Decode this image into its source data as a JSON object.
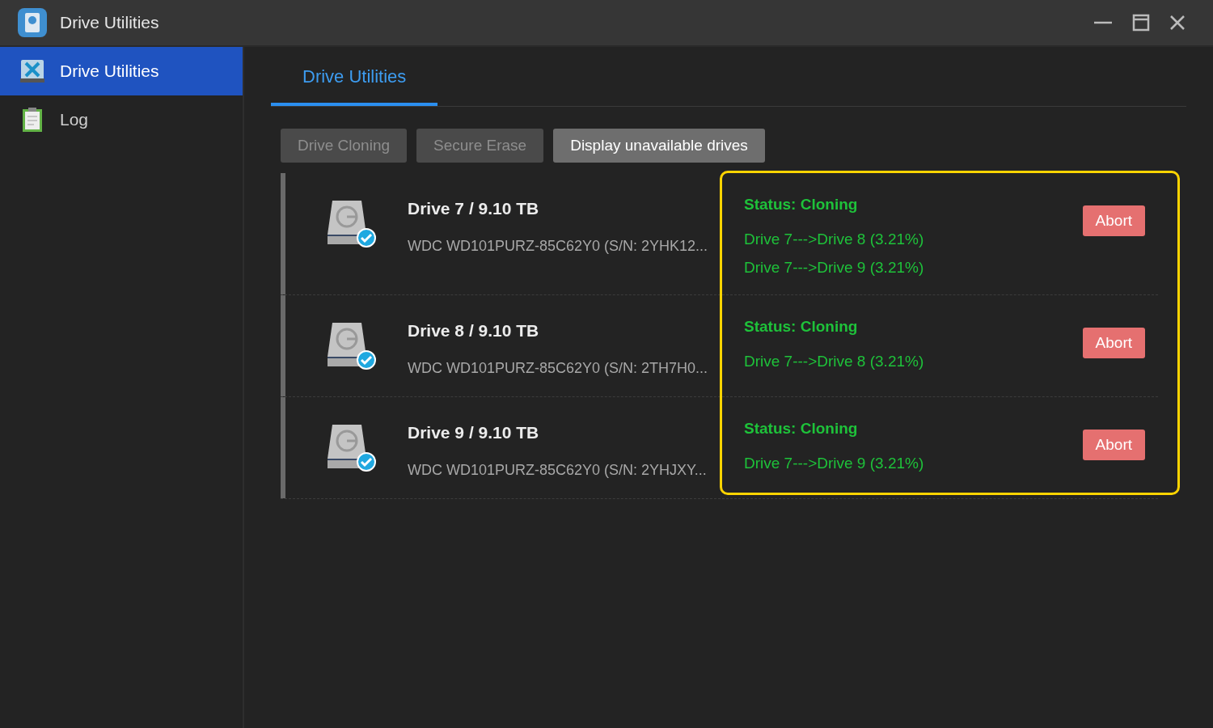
{
  "window": {
    "title": "Drive Utilities"
  },
  "sidebar": {
    "items": [
      {
        "label": "Drive Utilities",
        "kind": "utilities",
        "selected": true
      },
      {
        "label": "Log",
        "kind": "log",
        "selected": false
      }
    ]
  },
  "tabs": [
    {
      "label": "Drive Utilities",
      "selected": true
    }
  ],
  "toolbar": [
    {
      "label": "Drive Cloning",
      "disabled": true
    },
    {
      "label": "Secure Erase",
      "disabled": true
    },
    {
      "label": "Display unavailable drives",
      "disabled": false
    }
  ],
  "drives": [
    {
      "title": "Drive 7 / 9.10 TB",
      "model": "WDC WD101PURZ-85C62Y0 (S/N: 2YHK12...",
      "status": "Status: Cloning",
      "progress": [
        "Drive 7--->Drive 8 (3.21%)",
        "Drive 7--->Drive 9 (3.21%)"
      ],
      "action": "Abort"
    },
    {
      "title": "Drive 8 / 9.10 TB",
      "model": "WDC WD101PURZ-85C62Y0 (S/N: 2TH7H0...",
      "status": "Status: Cloning",
      "progress": [
        "Drive 7--->Drive 8 (3.21%)"
      ],
      "action": "Abort"
    },
    {
      "title": "Drive 9 / 9.10 TB",
      "model": "WDC WD101PURZ-85C62Y0 (S/N: 2YHJXY...",
      "status": "Status: Cloning",
      "progress": [
        "Drive 7--->Drive 9 (3.21%)"
      ],
      "action": "Abort"
    }
  ]
}
